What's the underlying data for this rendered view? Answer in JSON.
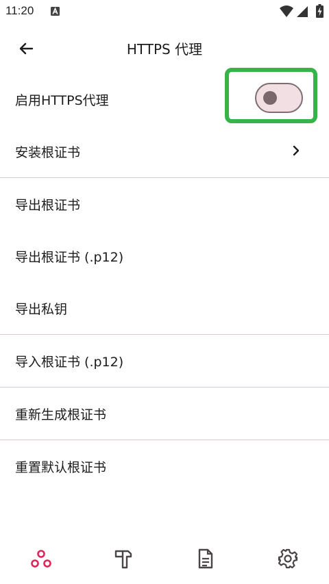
{
  "status_bar": {
    "time": "11:20",
    "notification_icon": "a-letter-icon",
    "wifi_icon": "wifi-icon",
    "signal_icon": "signal-icon",
    "battery_icon": "battery-charging-icon"
  },
  "app_bar": {
    "title": "HTTPS 代理",
    "back_icon": "arrow-left-icon"
  },
  "settings": {
    "enable_https_proxy": {
      "label": "启用HTTPS代理",
      "enabled": false
    },
    "install_root_cert": {
      "label": "安装根证书",
      "icon": "chevron-right-icon"
    },
    "export_root_cert": {
      "label": "导出根证书"
    },
    "export_root_cert_p12": {
      "label": "导出根证书 (.p12)"
    },
    "export_private_key": {
      "label": "导出私钥"
    },
    "import_root_cert_p12": {
      "label": "导入根证书 (.p12)"
    },
    "regenerate_root_cert": {
      "label": "重新生成根证书"
    },
    "reset_default_root_cert": {
      "label": "重置默认根证书"
    }
  },
  "bottom_nav": {
    "items": [
      {
        "icon": "network-nodes-icon",
        "active": true
      },
      {
        "icon": "hammer-icon",
        "active": false
      },
      {
        "icon": "document-icon",
        "active": false
      },
      {
        "icon": "gear-icon",
        "active": false
      }
    ]
  },
  "colors": {
    "accent": "#e0255a",
    "highlight": "#37b34a",
    "switch_track": "#f2dfe3",
    "switch_border": "#7f6b71",
    "divider": "#d9c8cf",
    "icon": "#4a4447"
  }
}
